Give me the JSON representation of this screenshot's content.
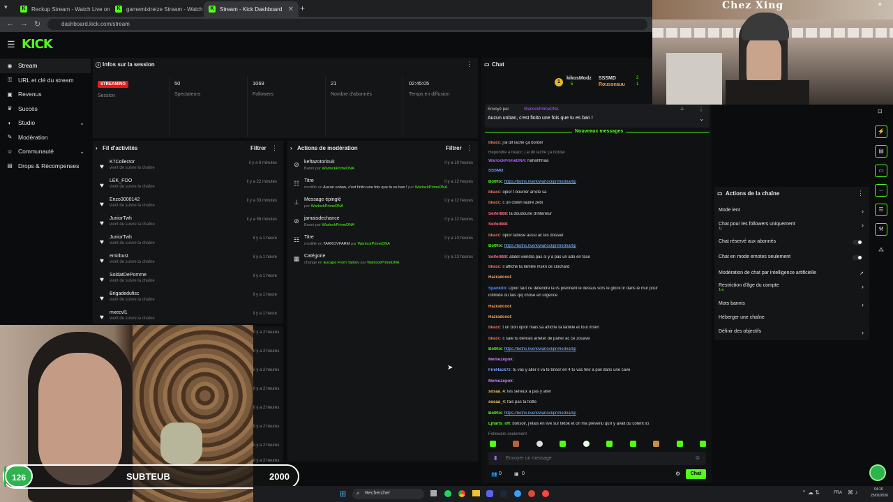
{
  "browser": {
    "tabs": [
      {
        "title": "Reckup Stream - Watch Live on",
        "active": false
      },
      {
        "title": "gamemixtreize Stream - Watch",
        "active": false
      },
      {
        "title": "Stream - Kick Dashboard",
        "active": true
      }
    ],
    "url": "dashboard.kick.com/stream"
  },
  "brand": {
    "logo": "KICK",
    "accent": "#53fc18"
  },
  "sidebar": {
    "items": [
      {
        "label": "Stream",
        "icon": "broadcast-icon"
      },
      {
        "label": "URL et clé du stream",
        "icon": "key-icon"
      },
      {
        "label": "Revenus",
        "icon": "money-icon"
      },
      {
        "label": "Succès",
        "icon": "trophy-icon"
      },
      {
        "label": "Studio",
        "icon": "studio-icon",
        "chev": "⌄"
      },
      {
        "label": "Modération",
        "icon": "wrench-icon"
      },
      {
        "label": "Communauté",
        "icon": "people-icon",
        "chev": "⌄"
      },
      {
        "label": "Drops & Récompenses",
        "icon": "gift-icon"
      }
    ]
  },
  "session": {
    "title": "Infos sur la session",
    "badge": "STREAMING",
    "stats": [
      {
        "value": "",
        "label": "Session"
      },
      {
        "value": "50",
        "label": "Spectateurs"
      },
      {
        "value": "1069",
        "label": "Followers"
      },
      {
        "value": "21",
        "label": "Nombre d'abonnés"
      },
      {
        "value": "02:45:05",
        "label": "Temps en diffusion"
      }
    ]
  },
  "activity": {
    "title": "Fil d'activités",
    "filter": "Filtrer",
    "items": [
      {
        "name": "K7Collector",
        "sub": "vient de suivre la chaîne",
        "time": "il y a 6 minutes"
      },
      {
        "name": "LEK_FOO",
        "sub": "vient de suivre la chaîne",
        "time": "il y a 22 minutes"
      },
      {
        "name": "Enzo3000142",
        "sub": "vient de suivre la chaîne",
        "time": "il y a 33 minutes"
      },
      {
        "name": "JuniorTwh",
        "sub": "vient de suivre la chaîne",
        "time": "il y a 58 minutes"
      },
      {
        "name": "JuniorTwh",
        "sub": "vient de suivre la chaîne",
        "time": "il y a 1 heure"
      },
      {
        "name": "emirbust",
        "sub": "vient de suivre la chaîne",
        "time": "il y a 1 heure"
      },
      {
        "name": "SoldatDePomme",
        "sub": "vient de suivre la chaîne",
        "time": "il y a 1 heure"
      },
      {
        "name": "Brigadedufisc",
        "sub": "vient de suivre la chaîne",
        "time": "il y a 1 heure"
      },
      {
        "name": "mxecvl1",
        "sub": "vient de suivre la chaîne",
        "time": "il y a 1 heure"
      }
    ],
    "more_times": [
      "il y a 2 heures",
      "il y a 2 heures",
      "il y a 2 heures",
      "il y a 2 heures",
      "il y a 2 heures",
      "il y a 2 heures",
      "il y a 2 heures",
      "il y a 2 heures"
    ]
  },
  "moderation": {
    "title": "Actions de modération",
    "filter": "Filtrer",
    "items": [
      {
        "icon": "ban-icon",
        "name": "keftazotorlouk",
        "sub": "Banni par",
        "by": "WarlockPrimeDNA",
        "time": "il y a 10 heures"
      },
      {
        "icon": "title-icon",
        "name": "Titre",
        "sub": "modifié en",
        "value": "Aucun unban, c'est finito une fois que tu es ban !",
        "by_pre": "par",
        "by": "WarlockPrimeDNA",
        "time": "il y a 12 heures"
      },
      {
        "icon": "pin-icon",
        "name": "Message épinglé",
        "sub": "par",
        "by": "WarlockPrimeDNA",
        "time": "il y a 12 heures"
      },
      {
        "icon": "ban-icon",
        "name": "jamaisdechance",
        "sub": "Banni par",
        "by": "WarlockPrimeDNA",
        "time": "il y a 12 heures"
      },
      {
        "icon": "title-icon",
        "name": "Titre",
        "sub": "modifié en",
        "value": "TARKOVFARM",
        "by_pre": "par",
        "by": "WarlockPrimeDNA",
        "time": "il y a 13 heures"
      },
      {
        "icon": "category-icon",
        "name": "Catégorie",
        "sub": "changé en",
        "value": "Escape From Tarkov",
        "by_pre": "par",
        "by": "WarlockPrimeDNA",
        "time": "il y a 13 heures"
      }
    ]
  },
  "chat": {
    "title": "Chat",
    "leaders": [
      {
        "name": "kikosModz",
        "count": "5"
      },
      {
        "name": "SSSMD",
        "count": "2"
      },
      {
        "name": "Rousseauu",
        "count": "1"
      }
    ],
    "pinned": {
      "by_label": "Envoyé par",
      "by": "WarlockPrimeDNA",
      "text": "Aucun unban, c'est finito une fois que tu es ban !"
    },
    "new_messages": "Nouveaux messages",
    "messages": [
      {
        "user": "bkacc",
        "color": "#e07a5f",
        "text": "j'ai dit lache ça bordel"
      },
      {
        "user": "",
        "color": "#888",
        "text": "Répondre à bkacc: j'ai dit lache ça bordel"
      },
      {
        "user": "WarlockPrimeDNA",
        "color": "#b05cff",
        "text": "hahahhhaa"
      },
      {
        "user": "SSSMD",
        "color": "#7aa2ff",
        "text": ""
      },
      {
        "user": "BotRix",
        "color": "#53fc18",
        "text": "https://botrix.live/k/warlockprimedna/tip"
      },
      {
        "user": "bkacc",
        "color": "#e07a5f",
        "text": "opior t bourrer arrete sa"
      },
      {
        "user": "bkacc",
        "color": "#e07a5f",
        "text": "c un clown lautre zebi"
      },
      {
        "user": "Seifer888",
        "color": "#ff6b81",
        "text": "la doudoune d'interieur"
      },
      {
        "user": "Seifer888",
        "color": "#ff6b81",
        "text": ""
      },
      {
        "user": "bkacc",
        "color": "#e07a5f",
        "text": "opior tabuse aussi ac tes dossier"
      },
      {
        "user": "BotRix",
        "color": "#53fc18",
        "text": "https://botrix.live/k/warlockprimedna/tip"
      },
      {
        "user": "Seifer888",
        "color": "#ff6b81",
        "text": "abdel viendra pas si y a pas un ado en face"
      },
      {
        "user": "bkacc",
        "color": "#e07a5f",
        "text": "il affiche ta famille mskn ce clochard"
      },
      {
        "user": "Hazradcool",
        "color": "#f4a259",
        "text": ""
      },
      {
        "user": "Spankito",
        "color": "#4d96ff",
        "text": "Opior faut ce défendre là ils prennent le dessus sors le glock tir dans le mur pour"
      },
      {
        "user": "",
        "color": "#ddd",
        "text": "intimidé ou fais qlq chose en urgence"
      },
      {
        "user": "Hazradcool",
        "color": "#f4a259",
        "text": ""
      },
      {
        "user": "Hazradcool",
        "color": "#f4a259",
        "text": ""
      },
      {
        "user": "bkacc",
        "color": "#e07a5f",
        "text": "t un bon opior mais sa affiche ta famille et tout mskn"
      },
      {
        "user": "bkacc",
        "color": "#e07a5f",
        "text": "c sale tu devrais arreter de parler ac ce zouave"
      },
      {
        "user": "BotRix",
        "color": "#53fc18",
        "text": "https://botrix.live/k/warlockprimedna/tip"
      },
      {
        "user": "MemeZepok",
        "color": "#c77dff",
        "text": ""
      },
      {
        "user": "FireHack7z",
        "color": "#7aa2ff",
        "text": "tu vas y aller il va te briser en 4 tu vas finir a poil dans une cave"
      },
      {
        "user": "MemeZepok",
        "color": "#c77dff",
        "text": ""
      },
      {
        "user": "sosaa_4",
        "color": "#e9c46a",
        "text": "tes serieux a pas y aller"
      },
      {
        "user": "sosaa_4",
        "color": "#e9c46a",
        "text": "fais pas ta fiotte"
      },
      {
        "user": "BotRix",
        "color": "#53fc18",
        "text": "https://botrix.live/k/warlockprimedna/tip"
      },
      {
        "user": "Ljharts_off",
        "color": "#53fc18",
        "text": "bonsoir, j'étais en live sur tiktok et on ma prévenu qu'il y avait du cotent ici"
      }
    ],
    "followers_only": "Followers seulement",
    "input_placeholder": "Envoyer un message",
    "viewer_count": "0",
    "points": "0",
    "send_label": "Chat"
  },
  "channel_actions": {
    "title": "Actions de la chaîne",
    "items": [
      {
        "label": "Mode lent",
        "kind": "chev",
        "sub": ""
      },
      {
        "label": "Chat pour les followers uniquement",
        "kind": "chev",
        "sub": "1j"
      },
      {
        "label": "Chat réservé aux abonnés",
        "kind": "toggle",
        "sub": ""
      },
      {
        "label": "Chat en mode emotes seulement",
        "kind": "toggle",
        "sub": ""
      },
      {
        "label": "Modération de chat par intelligence artificielle",
        "kind": "ext",
        "sub": ""
      },
      {
        "label": "Restriction d'âge du compte",
        "kind": "chev",
        "sub": "1m"
      },
      {
        "label": "Mots bannis",
        "kind": "chev",
        "sub": ""
      },
      {
        "label": "Héberger une chaîne",
        "kind": "none",
        "sub": ""
      },
      {
        "label": "Définir des objectifs",
        "kind": "chev",
        "sub": ""
      }
    ]
  },
  "overlay": {
    "cam_sign": "Chez Xing",
    "sub_count": "126",
    "sub_label": "SUBTEUB",
    "sub_goal": "2000"
  },
  "taskbar": {
    "search_placeholder": "Rechercher",
    "lang": "FRA",
    "time": "04:16",
    "date": "25/02/2026"
  }
}
